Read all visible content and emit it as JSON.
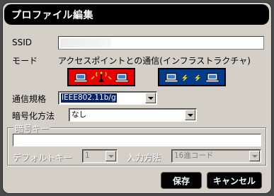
{
  "dialog": {
    "title": "プロファイル編集"
  },
  "ssid": {
    "label": "SSID",
    "value": ""
  },
  "mode": {
    "label": "モード",
    "value": "アクセスポイントとの通信(インフラストラクチャ)"
  },
  "standard": {
    "label": "通信規格",
    "value": "IEEE802.11b/g"
  },
  "encryption": {
    "label": "暗号化方法",
    "value": "なし"
  },
  "key_group": {
    "legend": "暗号キー",
    "key_value": "",
    "default_key_label": "デフォルトキー",
    "default_key_value": "1",
    "input_method_label": "入力方法",
    "input_method_value": "16進コード"
  },
  "buttons": {
    "save": "保存",
    "cancel": "キャンセル"
  },
  "colors": {
    "adhoc_button": "#e80000",
    "infra_button": "#003b8c",
    "title_bar": "#000000",
    "panel": "#d4d0c8"
  },
  "icons": {
    "adhoc_mode": "computers-to-access-point-icon",
    "infra_mode": "computer-to-computer-icon"
  }
}
